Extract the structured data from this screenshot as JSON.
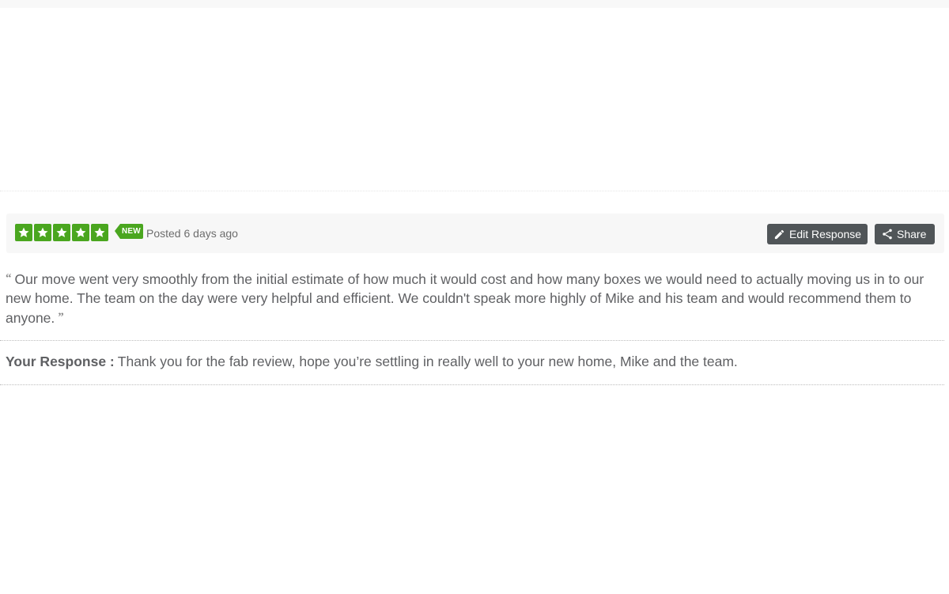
{
  "review": {
    "rating": 5,
    "rating_max": 5,
    "new_badge": "NEW",
    "posted": "Posted 6 days ago",
    "text": "Our move went very smoothly from the initial estimate of how much it would cost and how many boxes we would need to actually moving us in to our new home. The team on the day were very helpful and efficient. We couldn't speak more highly of Mike and his team and would recommend them to anyone.",
    "quote_open": "“",
    "quote_close": "”"
  },
  "actions": {
    "edit_label": "Edit Response",
    "edit_icon": "pencil-icon",
    "share_label": "Share",
    "share_icon": "share-icon"
  },
  "response": {
    "label": "Your Response :",
    "text": "Thank you for the fab review, hope you’re settling in really well to your new home, Mike and the team."
  },
  "colors": {
    "star_green": "#4aa61f",
    "button_bg": "#505558",
    "text": "#5f6063"
  }
}
